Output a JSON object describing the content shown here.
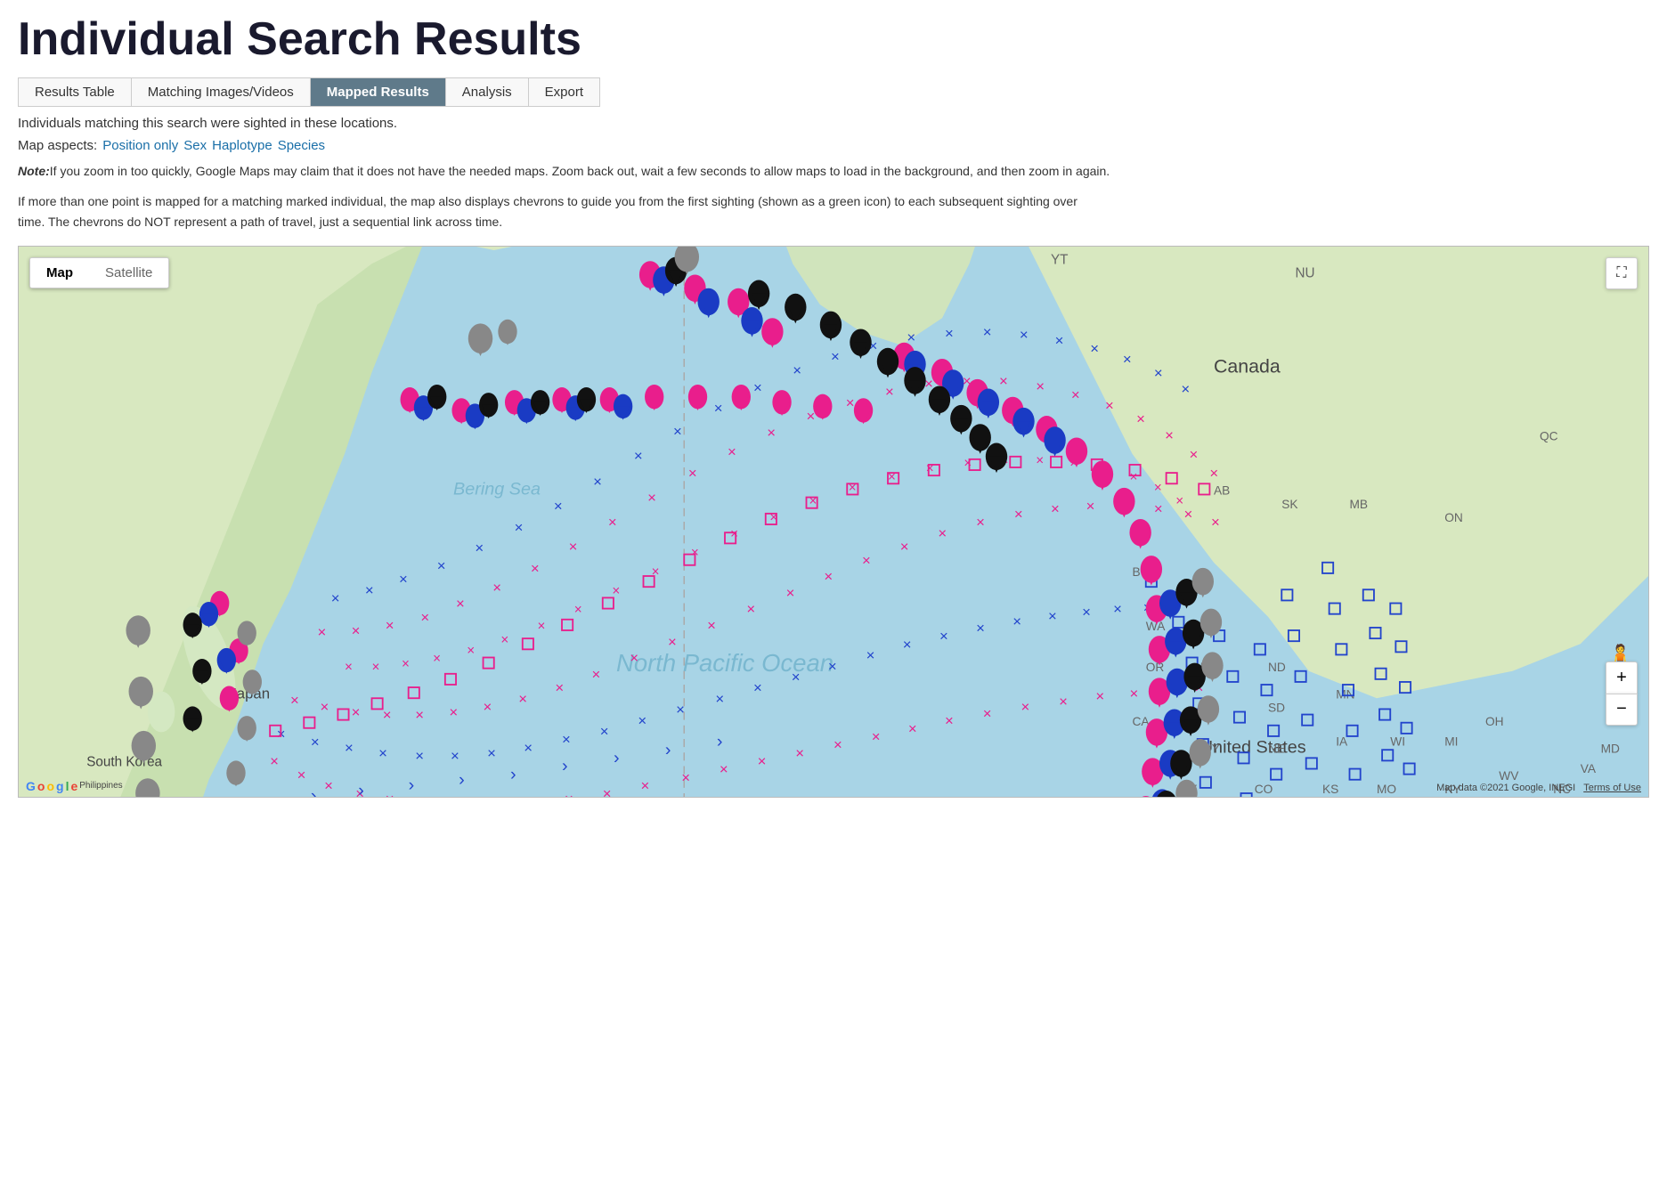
{
  "page": {
    "title": "Individual Search Results",
    "subtitle": "Individuals matching this search were sighted in these locations.",
    "map_aspects_label": "Map aspects:",
    "note_label": "Note:",
    "note_text": "If you zoom in too quickly, Google Maps may claim that it does not have the needed maps. Zoom back out, wait a few seconds to allow maps to load in the background, and then zoom in again.",
    "chevron_note": "If more than one point is mapped for a matching marked individual, the map also displays chevrons to guide you from the first sighting (shown as a green icon) to each subsequent sighting over time. The chevrons do NOT represent a path of travel, just a sequential link across time.",
    "map_footer": "Map data ©2021 Google, INEGI",
    "terms_label": "Terms of Use"
  },
  "tabs": [
    {
      "id": "results-table",
      "label": "Results Table",
      "active": false
    },
    {
      "id": "matching-images",
      "label": "Matching Images/Videos",
      "active": false
    },
    {
      "id": "mapped-results",
      "label": "Mapped Results",
      "active": true
    },
    {
      "id": "analysis",
      "label": "Analysis",
      "active": false
    },
    {
      "id": "export",
      "label": "Export",
      "active": false
    }
  ],
  "map_aspects": [
    {
      "id": "position-only",
      "label": "Position only"
    },
    {
      "id": "sex",
      "label": "Sex"
    },
    {
      "id": "haplotype",
      "label": "Haplotype"
    },
    {
      "id": "species",
      "label": "Species"
    }
  ],
  "map": {
    "type_map_label": "Map",
    "type_satellite_label": "Satellite",
    "active_type": "Map",
    "zoom_in_label": "+",
    "zoom_out_label": "−",
    "pegman": "🧍",
    "fullscreen_icon": "⛶"
  }
}
